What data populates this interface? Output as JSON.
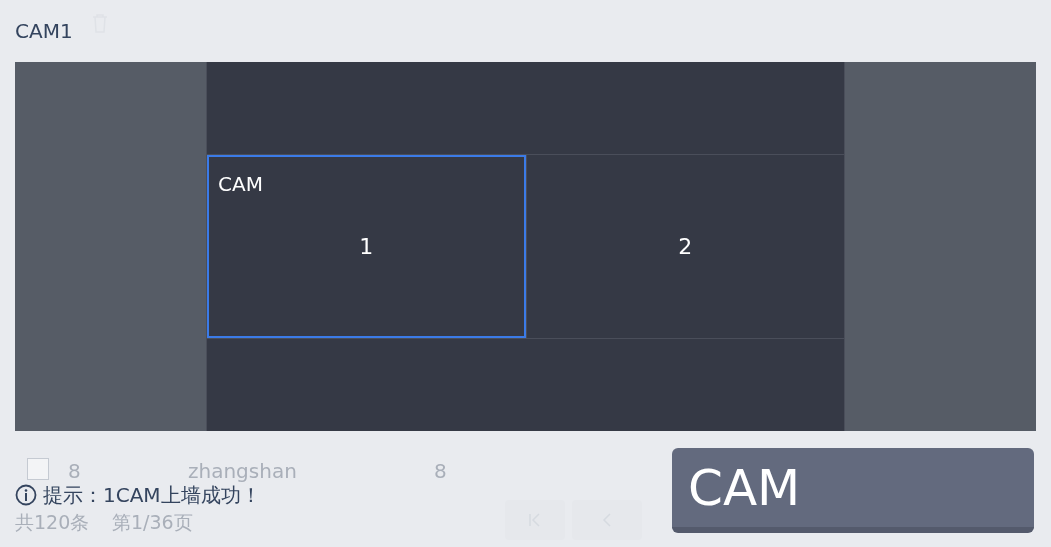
{
  "background_page": {
    "row_checked": false,
    "row": [
      "8",
      "zhangshan",
      "8"
    ],
    "summary": [
      "共120条",
      "第1/36页"
    ]
  },
  "title": "CAM1",
  "wall": {
    "cells": [
      {
        "number": "1",
        "label": "CAM",
        "selected": true
      },
      {
        "number": "2",
        "selected": false
      }
    ]
  },
  "tip": {
    "text": "提示：1CAM上墙成功！"
  },
  "button": {
    "label": "CAM"
  }
}
